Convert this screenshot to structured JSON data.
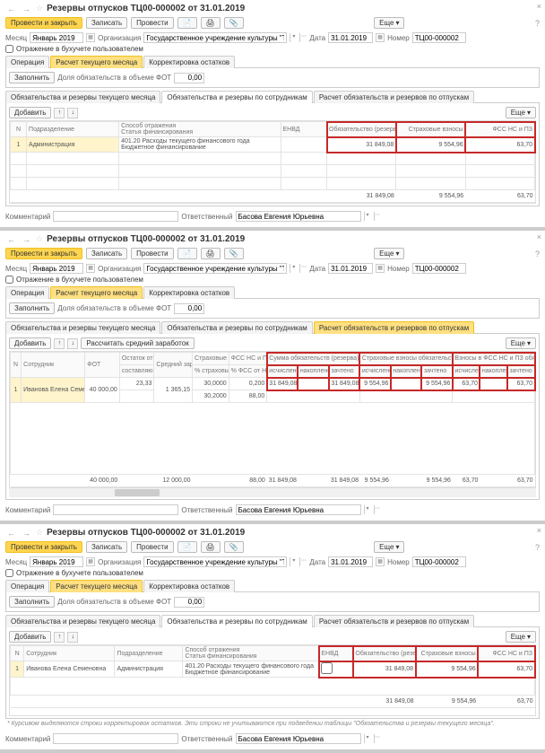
{
  "doc_title": "Резервы отпусков ТЦ00-000002 от 31.01.2019",
  "btn_main": "Провести и закрыть",
  "btn_save": "Записать",
  "btn_post": "Провести",
  "btn_more": "Еще",
  "lbl_month": "Месяц",
  "val_month": "Январь 2019",
  "lbl_org": "Организация",
  "val_org": "Государственное учреждение культуры \"Театральный центр\"",
  "lbl_date": "Дата",
  "val_date": "31.01.2019",
  "lbl_num": "Номер",
  "val_num": "ТЦ00-000002",
  "chk_acc": "Отражение в бухучете пользователем",
  "tab_ops": "Операция",
  "tab_calc": "Расчет текущего месяца",
  "tab_corr": "Корректировка остатков",
  "btn_fill": "Заполнить",
  "lbl_fot": "Доля обязательств в объеме ФОТ",
  "val_fot": "0,00",
  "sub1": "Обязательства и резервы текущего месяца",
  "sub2": "Обязательства и резервы по сотрудникам",
  "sub3": "Расчет обязательств и резервов по отпускам",
  "btn_add": "Добавить",
  "btn_recalc_avg": "Рассчитать средний заработок",
  "lbl_comment": "Комментарий",
  "lbl_resp": "Ответственный",
  "val_resp": "Басова Евгения Юрьевна",
  "t1": {
    "h": {
      "n": "N",
      "podr": "Подразделение",
      "spos": "Способ отражения",
      "stat": "Статья финансирования",
      "envd": "ЕНВД",
      "obaz": "Обязательство (резерв)",
      "strah": "Страховые взносы",
      "fss": "ФСС НС и ПЗ"
    },
    "r": {
      "n": "1",
      "podr": "Администрация",
      "desc": "401.20 Расходы текущего финансового года",
      "fin": "Бюджетное финансирование",
      "obaz": "31 849,08",
      "strah": "9 554,96",
      "fss": "63,70"
    }
  },
  "t2": {
    "h": {
      "n": "N",
      "emp": "Сотрудник",
      "fot": "ФОТ",
      "ost": "Остаток отпуска",
      "avg": "Средний заработок",
      "sv": "Страховые взносы",
      "fssp": "ФСС НС и ПЗ",
      "sum": "Сумма обязательств (резерва)",
      "svob": "Страховые взносы обязательство (резерв)",
      "fssvz": "Взносы в ФСС НС и ПЗ обязательство (резерв)"
    },
    "h2": {
      "sost": "составляющих месяцев",
      "pct": "% страховых",
      "pctfss": "% ФСС от НС и ПЗ",
      "isc": "исчислено",
      "nak": "накоплено",
      "zac": "зачтено"
    },
    "r": {
      "n": "1",
      "emp": "Иванова Елена Семеновна",
      "fot": "40 000,00",
      "ost": "23,33",
      "avg": "1 365,15",
      "sv": "30,0000",
      "fss": "0,200",
      "sum1": "31 849,08",
      "sum2": "31 849,08",
      "sv1": "9 554,96",
      "sv2": "9 554,96",
      "fz1": "63,70",
      "fz2": "63,70",
      "pctv": "30,2000",
      "fotv": "88,00"
    },
    "foot": {
      "fot": "40 000,00",
      "avg": "12 000,00",
      "fss": "88,00",
      "s1": "31 849,08",
      "s2": "31 849,08",
      "sv1": "9 554,96",
      "sv2": "9 554,96",
      "f1": "63,70",
      "f2": "63,70"
    }
  },
  "t3": {
    "h": {
      "n": "N",
      "emp": "Сотрудник",
      "podr": "Подразделение",
      "spos": "Способ отражения",
      "stat": "Статья финансирования",
      "envd": "ЕНВД",
      "obaz": "Обязательство (резерв)",
      "strah": "Страховые взносы",
      "fss": "ФСС НС и ПЗ"
    },
    "r": {
      "n": "1",
      "emp": "Иванова Елена Семеновна",
      "podr": "Администрация",
      "desc": "401.20 Расходы текущего финансового года",
      "fin": "Бюджетное финансирование",
      "obaz": "31 849,08",
      "strah": "9 554,96",
      "fss": "63,70"
    }
  },
  "note": "* Курсивом выделяются строки корректировок остатков. Эти строки не учитываются при подведении таблицы \"Обязательства и резервы текущего месяца\"."
}
